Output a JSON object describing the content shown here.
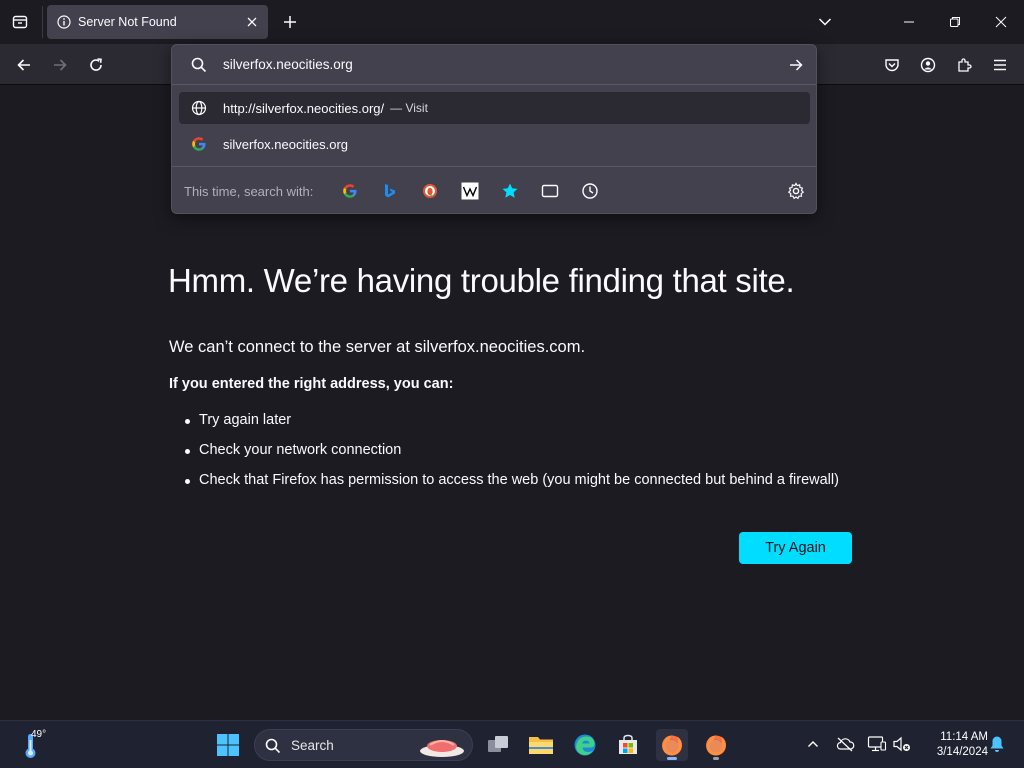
{
  "window": {
    "tab_title": "Server Not Found"
  },
  "urlbar": {
    "typed_text": "silverfox.neocities.org",
    "results": [
      {
        "title": "http://silverfox.neocities.org/",
        "action": "— Visit",
        "icon": "globe-icon",
        "selected": true
      },
      {
        "title": "silverfox.neocities.org",
        "action": "",
        "icon": "google-icon",
        "selected": false
      }
    ],
    "search_with_label": "This time, search with:",
    "engines": [
      "google-icon",
      "bing-icon",
      "duckduckgo-icon",
      "wikipedia-icon",
      "bookmarks-icon",
      "tabs-icon",
      "history-icon"
    ]
  },
  "page": {
    "title": "Hmm. We’re having trouble finding that site.",
    "description": "We can’t connect to the server at silverfox.neocities.com.",
    "subtitle": "If you entered the right address, you can:",
    "suggestions": [
      "Try again later",
      "Check your network connection",
      "Check that Firefox has permission to access the web (you might be connected but behind a firewall)"
    ],
    "try_again_label": "Try Again",
    "accent_color": "#00ddff"
  },
  "taskbar": {
    "weather_temp": "49°",
    "search_label": "Search",
    "time": "11:14 AM",
    "date": "3/14/2024"
  }
}
